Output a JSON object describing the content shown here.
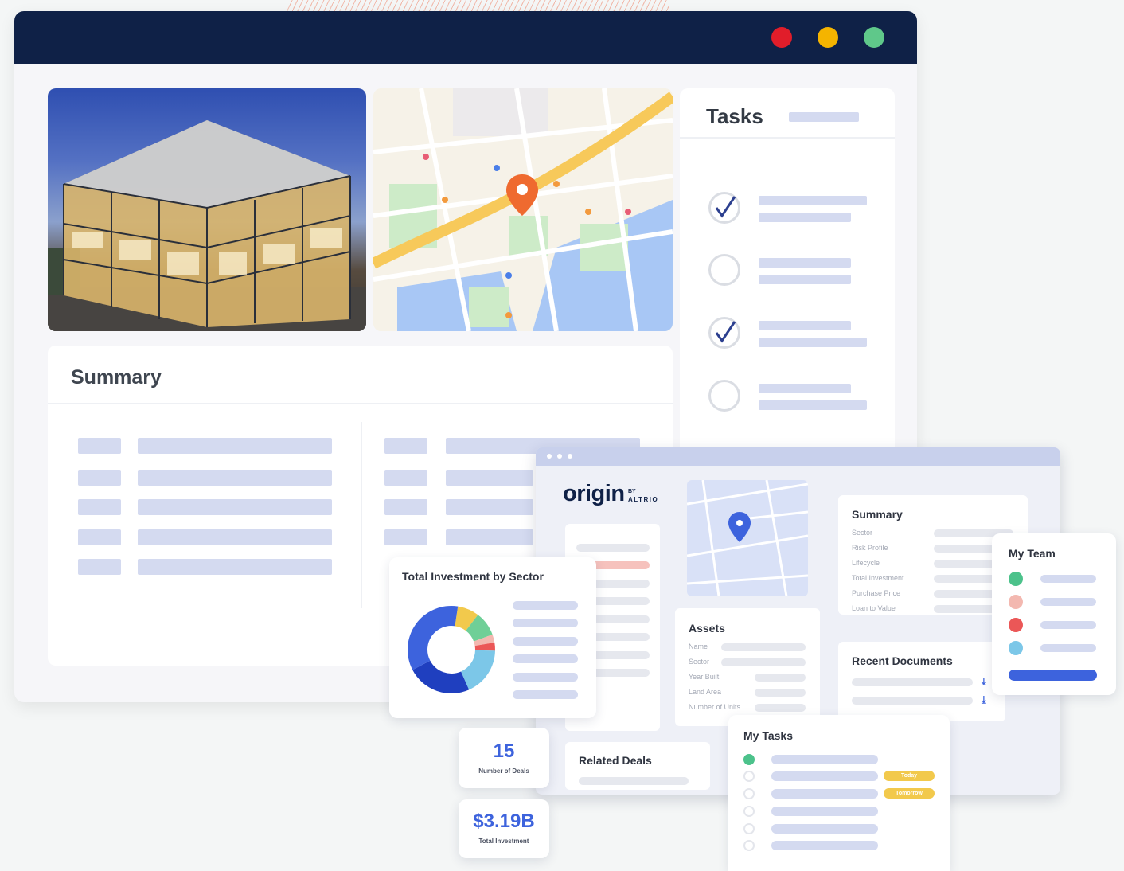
{
  "tasks": {
    "title": "Tasks"
  },
  "summary": {
    "title": "Summary"
  },
  "origin": {
    "brand_main": "origin",
    "brand_by": "BY",
    "brand_sub": "ALTRIO",
    "summary": {
      "title": "Summary",
      "fields": [
        "Sector",
        "Risk Profile",
        "Lifecycle",
        "Total Investment",
        "Purchase Price",
        "Loan to Value"
      ]
    },
    "assets": {
      "title": "Assets",
      "fields": [
        "Name",
        "Sector",
        "Year Built",
        "Land Area",
        "Number of Units"
      ]
    },
    "recent_documents": {
      "title": "Recent Documents"
    },
    "related_deals": {
      "title": "Related Deals"
    },
    "my_team": {
      "title": "My Team"
    },
    "my_tasks": {
      "title": "My Tasks",
      "badge_today": "Today",
      "badge_tomorrow": "Tomorrow"
    }
  },
  "investment": {
    "title": "Total Investment by Sector",
    "chart_data": {
      "type": "pie",
      "slices": [
        {
          "value": 8,
          "color": "#f2c94c"
        },
        {
          "value": 9,
          "color": "#6fcf97"
        },
        {
          "value": 3,
          "color": "#f3b8b0"
        },
        {
          "value": 3,
          "color": "#eb5757"
        },
        {
          "value": 18,
          "color": "#7cc7e8"
        },
        {
          "value": 24,
          "color": "#1f3fbf"
        },
        {
          "value": 35,
          "color": "#3d63dd"
        }
      ]
    }
  },
  "stats": {
    "deals_value": "15",
    "deals_label": "Number of Deals",
    "investment_value": "$3.19B",
    "investment_label": "Total Investment"
  },
  "colors": {
    "brand_navy": "#0f2147",
    "accent_blue": "#3d63dd",
    "green": "#4cc28b",
    "yellow": "#f2c94c"
  }
}
